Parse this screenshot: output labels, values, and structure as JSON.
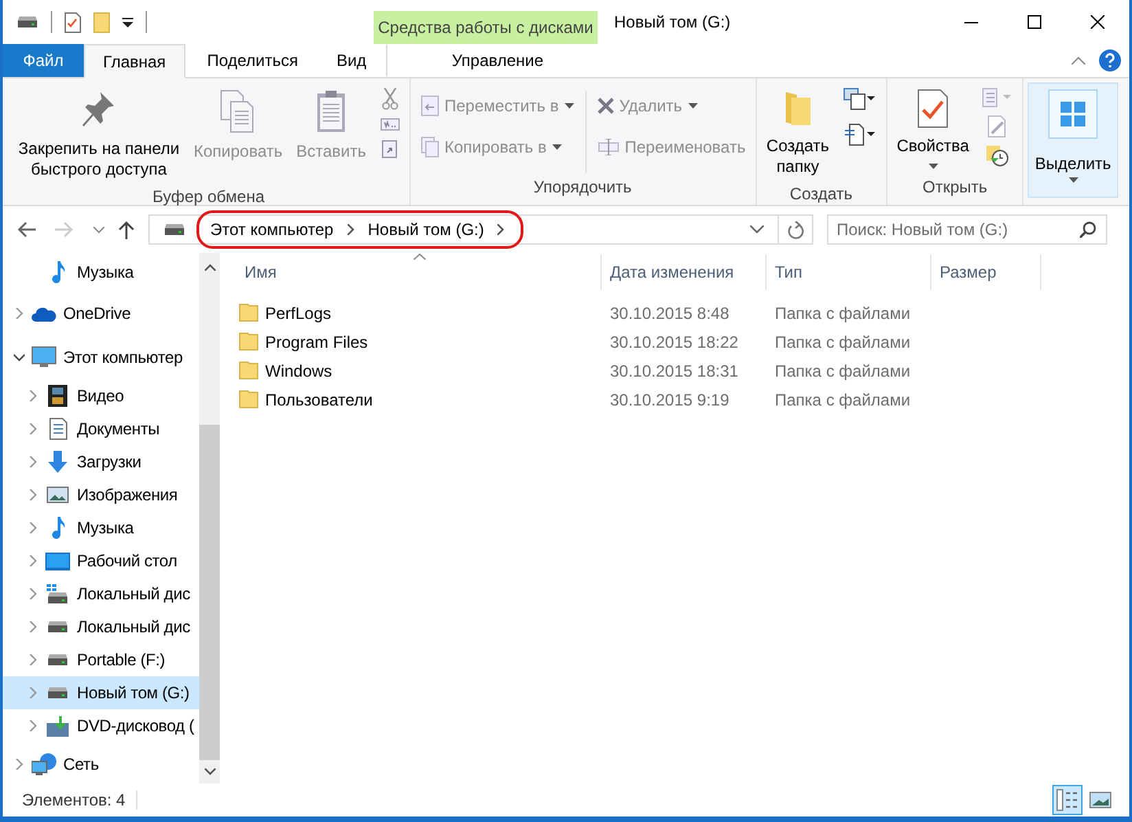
{
  "context_tab_group": {
    "label": "Средства работы с дисками"
  },
  "window": {
    "title": "Новый том (G:)"
  },
  "tabs": [
    {
      "label": "Файл",
      "kind": "file",
      "selected": false
    },
    {
      "label": "Главная",
      "kind": "normal",
      "selected": true
    },
    {
      "label": "Поделиться",
      "kind": "normal",
      "selected": false
    },
    {
      "label": "Вид",
      "kind": "normal",
      "selected": false
    },
    {
      "label": "Управление",
      "kind": "context",
      "selected": false
    }
  ],
  "ribbon": {
    "groups": [
      {
        "title": "Буфер обмена",
        "commands": [
          {
            "label": "Закрепить на панели быстрого доступа",
            "disabled": false
          },
          {
            "label": "Копировать",
            "disabled": true
          },
          {
            "label": "Вставить",
            "disabled": true
          }
        ]
      },
      {
        "title": "Упорядочить",
        "commands": [
          {
            "label": "Переместить в",
            "disabled": true
          },
          {
            "label": "Копировать в",
            "disabled": true
          },
          {
            "label": "Удалить",
            "disabled": true
          },
          {
            "label": "Переименовать",
            "disabled": true
          }
        ]
      },
      {
        "title": "Создать",
        "commands": [
          {
            "label": "Создать папку",
            "disabled": false
          }
        ]
      },
      {
        "title": "Открыть",
        "commands": [
          {
            "label": "Свойства",
            "disabled": false
          }
        ]
      },
      {
        "commands": [
          {
            "label": "Выделить",
            "disabled": false,
            "highlighted": true
          }
        ]
      }
    ]
  },
  "address_bar": {
    "nav_buttons": [
      {
        "kind": "back",
        "disabled": false
      },
      {
        "kind": "forward",
        "disabled": true
      },
      {
        "kind": "recent",
        "disabled": false
      },
      {
        "kind": "up",
        "disabled": false
      }
    ],
    "breadcrumb": [
      "Этот компьютер",
      "Новый том (G:)"
    ]
  },
  "search": {
    "placeholder": "Поиск: Новый том (G:)"
  },
  "navigation_pane": {
    "quick_access_tail": [
      {
        "label": "Музыка",
        "kind": "music"
      }
    ],
    "tree": [
      {
        "label": "OneDrive",
        "kind": "onedrive",
        "expanded": false,
        "selected": false
      },
      {
        "label": "Этот компьютер",
        "kind": "computer",
        "expanded": true,
        "selected": false,
        "children": [
          {
            "label": "Видео",
            "kind": "video",
            "expanded": false,
            "selected": false
          },
          {
            "label": "Документы",
            "kind": "documents",
            "expanded": false,
            "selected": false
          },
          {
            "label": "Загрузки",
            "kind": "downloads",
            "expanded": false,
            "selected": false
          },
          {
            "label": "Изображения",
            "kind": "pictures",
            "expanded": false,
            "selected": false
          },
          {
            "label": "Музыка",
            "kind": "music",
            "expanded": false,
            "selected": false
          },
          {
            "label": "Рабочий стол",
            "kind": "desktop",
            "expanded": false,
            "selected": false
          },
          {
            "label": "Локальный дис",
            "kind": "system-drive",
            "expanded": false,
            "selected": false
          },
          {
            "label": "Локальный дис",
            "kind": "drive",
            "expanded": false,
            "selected": false
          },
          {
            "label": "Portable (F:)",
            "kind": "drive",
            "expanded": false,
            "selected": false
          },
          {
            "label": "Новый том (G:)",
            "kind": "drive",
            "expanded": false,
            "selected": true
          },
          {
            "label": "DVD-дисковод (",
            "kind": "dvd",
            "expanded": false,
            "selected": false
          }
        ]
      },
      {
        "label": "Сеть",
        "kind": "network",
        "expanded": false,
        "selected": false
      }
    ]
  },
  "file_list": {
    "columns": [
      {
        "label": "Имя",
        "sorted": true
      },
      {
        "label": "Дата изменения",
        "sorted": false
      },
      {
        "label": "Тип",
        "sorted": false
      },
      {
        "label": "Размер",
        "sorted": false
      }
    ],
    "rows": [
      {
        "name": "PerfLogs",
        "date": "30.10.2015 8:48",
        "type": "Папка с файлами"
      },
      {
        "name": "Program Files",
        "date": "30.10.2015 18:22",
        "type": "Папка с файлами"
      },
      {
        "name": "Windows",
        "date": "30.10.2015 18:31",
        "type": "Папка с файлами"
      },
      {
        "name": "Пользователи",
        "date": "30.10.2015 9:19",
        "type": "Папка с файлами"
      }
    ]
  },
  "status_bar": {
    "item_count": "Элементов: 4"
  },
  "view_buttons": [
    {
      "kind": "details",
      "selected": true
    },
    {
      "kind": "large-icons",
      "selected": false
    }
  ]
}
